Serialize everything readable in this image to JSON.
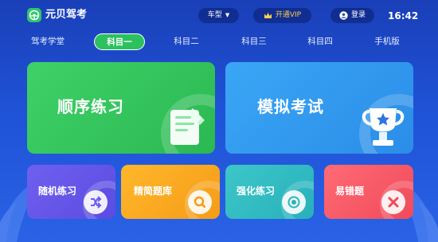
{
  "header": {
    "app_title": "元贝驾考",
    "car_type_label": "车型",
    "vip_label": "开通VIP",
    "login_label": "登录",
    "time": "16:42"
  },
  "tabs": [
    {
      "label": "驾考学堂"
    },
    {
      "label": "科目一"
    },
    {
      "label": "科目二"
    },
    {
      "label": "科目三"
    },
    {
      "label": "科目四"
    },
    {
      "label": "手机版"
    }
  ],
  "cards": {
    "sequential": {
      "label": "顺序练习"
    },
    "mock": {
      "label": "模拟考试"
    },
    "random": {
      "label": "随机练习"
    },
    "simple": {
      "label": "精简题库"
    },
    "strengthen": {
      "label": "强化练习"
    },
    "wrong": {
      "label": "易错题"
    }
  },
  "colors": {
    "background": "#1f52d6",
    "accent_green": "#2cc05f",
    "vip_gold": "#ffcf4d"
  }
}
